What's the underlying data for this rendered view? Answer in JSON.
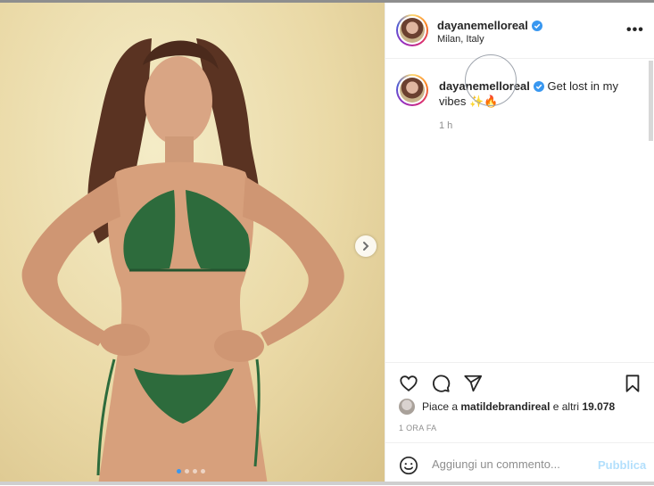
{
  "post": {
    "username": "dayanemelloreal",
    "location": "Milan, Italy",
    "caption": "Get lost in my vibes",
    "caption_emojis": "✨🔥",
    "time_ago": "1 h",
    "likes_prefix": "Piace a",
    "likes_user": "matildebrandireal",
    "likes_middle": "e altri",
    "likes_count": "19.078",
    "date_label": "1 ORA FA",
    "more_label": "•••"
  },
  "comment": {
    "placeholder": "Aggiungi un commento...",
    "publish_label": "Pubblica"
  },
  "carousel": {
    "total": 4,
    "active": 0
  },
  "icons": {
    "verified": "verified-badge-icon",
    "like": "heart-icon",
    "comment": "comment-icon",
    "share": "paper-plane-icon",
    "save": "bookmark-icon",
    "emoji": "smiley-icon",
    "next": "chevron-right-icon"
  },
  "colors": {
    "accent": "#3897f0",
    "publish_disabled": "#b2dffc",
    "bikini": "#2d6b3c"
  }
}
